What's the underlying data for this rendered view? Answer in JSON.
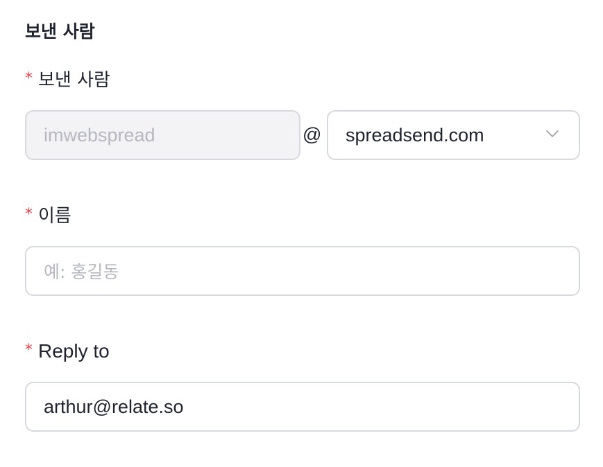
{
  "section": {
    "title": "보낸 사람"
  },
  "sender": {
    "label": "보낸 사람",
    "required_mark": "*",
    "local_part_placeholder": "imwebspread",
    "at_symbol": "@",
    "domain_value": "spreadsend.com",
    "domain_icon": "chevron-down-icon"
  },
  "name": {
    "label": "이름",
    "required_mark": "*",
    "placeholder": "예: 홍길동"
  },
  "reply_to": {
    "label": "Reply to",
    "required_mark": "*",
    "value": "arthur@relate.so"
  },
  "colors": {
    "required": "#e5484d",
    "border": "#d7d9e1",
    "disabled_bg": "#f3f3f5",
    "placeholder": "#b6b8c1",
    "text": "#1f2330"
  }
}
